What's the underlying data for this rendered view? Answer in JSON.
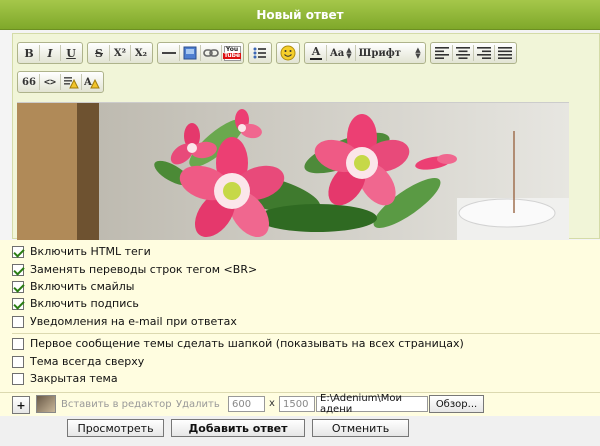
{
  "header": {
    "title": "Новый ответ"
  },
  "toolbar": {
    "bold": "B",
    "italic": "I",
    "underline": "U",
    "strike": "S",
    "superscript": "X²",
    "subscript": "X₂",
    "youtube_top": "You",
    "youtube_bottom": "Tube",
    "font_color": "A",
    "font_size": "Aa",
    "font_family": "Шрифт",
    "quote": "66",
    "code": "<>"
  },
  "options": [
    {
      "label": "Включить HTML теги",
      "checked": true
    },
    {
      "label": "Заменять переводы строк тегом <BR>",
      "checked": true
    },
    {
      "label": "Включить смайлы",
      "checked": true
    },
    {
      "label": "Включить подпись",
      "checked": true
    },
    {
      "label": "Уведомления на e-mail при ответах",
      "checked": false
    },
    {
      "label": "Первое сообщение темы сделать шапкой (показывать на всех страницах)",
      "checked": false
    },
    {
      "label": "Тема всегда сверху",
      "checked": false
    },
    {
      "label": "Закрытая тема",
      "checked": false
    }
  ],
  "upload": {
    "add": "+",
    "insert_text": "Вставить в редактор",
    "delete_text": "Удалить",
    "width": "600",
    "times": "x",
    "height": "1500",
    "path": "E:\\Adenium\\Мои адени",
    "browse": "Обзор..."
  },
  "buttons": {
    "preview": "Просмотреть",
    "submit": "Добавить ответ",
    "cancel": "Отменить"
  },
  "colors": {
    "header": "#8db335",
    "options_bg": "#fffde0",
    "editor_bg": "#f1f5d8"
  }
}
